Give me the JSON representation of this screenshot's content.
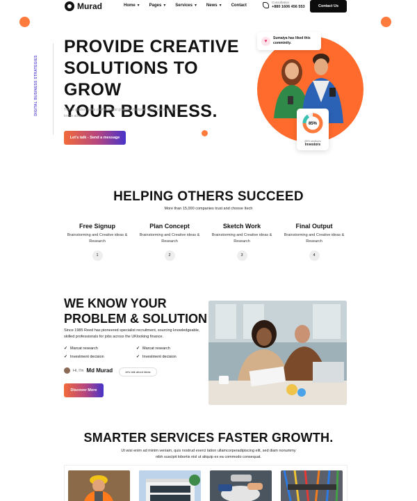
{
  "nav": {
    "logo": "Murad",
    "menu": [
      {
        "label": "Home",
        "dropdown": true
      },
      {
        "label": "Pages",
        "dropdown": true
      },
      {
        "label": "Services",
        "dropdown": true
      },
      {
        "label": "News",
        "dropdown": true
      },
      {
        "label": "Contact",
        "dropdown": false
      }
    ],
    "consultation_label": "Consultation",
    "phone": "+880 1606 456 553",
    "cta": "Contact Us"
  },
  "hero": {
    "vertical_tag": "DIGITAL BUSINESS STRATEGIES",
    "title_lines": [
      "PROVIDE CREATIVE",
      "SOLUTIONS TO GROW",
      "YOUR BUSINESS."
    ],
    "subtitle": "The 3 golden rules professional graphic designer don't want you to know about.",
    "cta": "Let's talk - Send a message",
    "liked_card": "Sumaiya has liked this comminity.",
    "investor_card": {
      "percent": "85%",
      "label": "85% startups",
      "name": "Investors",
      "fraction": 0.85
    },
    "accent_color": "#ff6b2c"
  },
  "helping": {
    "title": "HELPING OTHERS SUCCEED",
    "subtitle": "More than 15,000 companies trust and choose Itech",
    "steps": [
      {
        "title": "Free Signup",
        "desc": "Brainstorming and Creative ideas & Research",
        "num": "1"
      },
      {
        "title": "Plan Concept",
        "desc": "Brainstorming and Creative ideas & Research",
        "num": "2"
      },
      {
        "title": "Sketch Work",
        "desc": "Brainstorming and Creative ideas & Research",
        "num": "3"
      },
      {
        "title": "Final Output",
        "desc": "Brainstorming and Creative ideas & Research",
        "num": "4"
      }
    ]
  },
  "problem": {
    "title_lines": [
      "WE KNOW YOUR",
      "PROBLEM & SOLUTION"
    ],
    "desc": "Since 1985 Reed has pioneered specialist recruitment, sourcing knowledgeable, skilled professionals for jobs across the UKlooking finance.",
    "checks": [
      "Marcat research",
      "Marcat research",
      "Investment decision",
      "Investment decision"
    ],
    "author_hi": "Hi, I'm",
    "author_name": "Md Murad",
    "talk_label": "let's talk about ideas",
    "cta": "Discover More"
  },
  "services": {
    "title": "SMARTER SERVICES FASTER GROWTH.",
    "subtitle_lines": [
      "Ut wisi enim ad minim veniam, quis nostrud exerci tation ullamcorperadipiscing elit, sed diam nonummy",
      "nibh suscipit lobortis nisl ut aliquip ex ea commodo consequat."
    ]
  }
}
